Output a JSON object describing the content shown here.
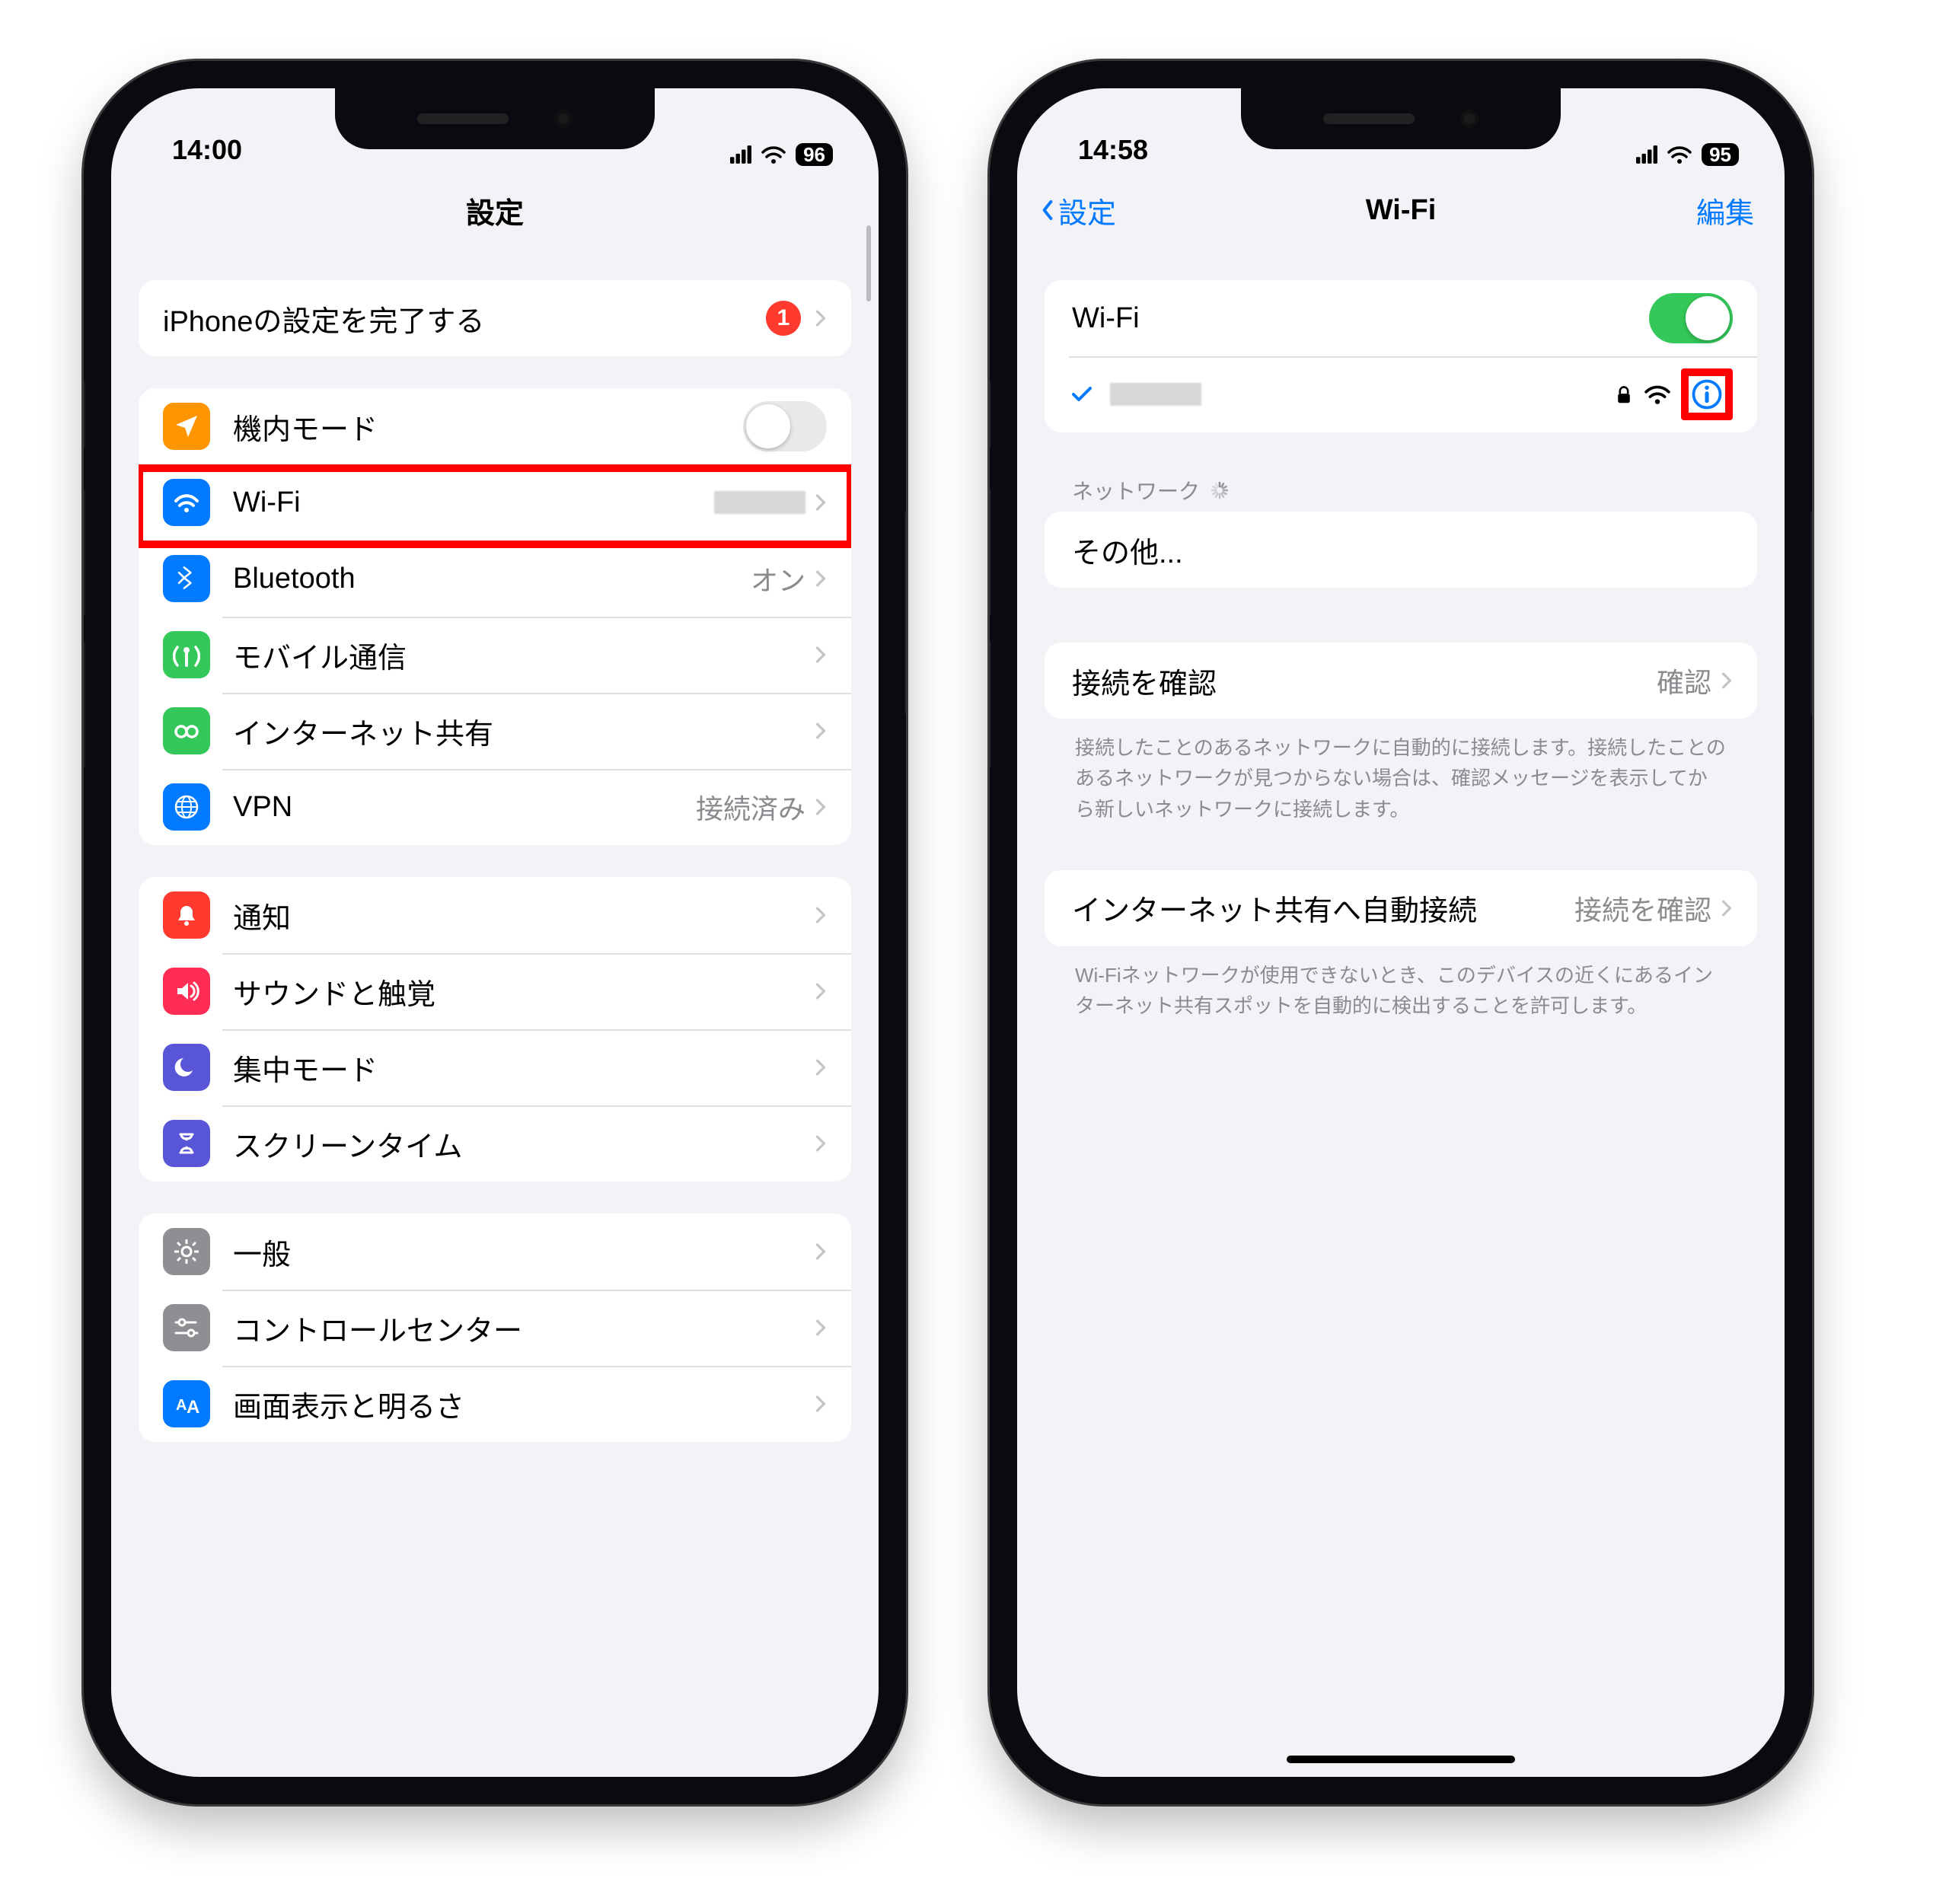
{
  "left": {
    "status": {
      "time": "14:00",
      "battery": "96"
    },
    "nav": {
      "title": "設定"
    },
    "setup": {
      "label": "iPhoneの設定を完了する",
      "badge": "1"
    },
    "group_net": {
      "airplane": {
        "label": "機内モード"
      },
      "wifi": {
        "label": "Wi-Fi"
      },
      "bluetooth": {
        "label": "Bluetooth",
        "detail": "オン"
      },
      "cellular": {
        "label": "モバイル通信"
      },
      "hotspot": {
        "label": "インターネット共有"
      },
      "vpn": {
        "label": "VPN",
        "detail": "接続済み"
      }
    },
    "group_notif": {
      "notifications": {
        "label": "通知"
      },
      "sounds": {
        "label": "サウンドと触覚"
      },
      "focus": {
        "label": "集中モード"
      },
      "screentime": {
        "label": "スクリーンタイム"
      }
    },
    "group_gen": {
      "general": {
        "label": "一般"
      },
      "control": {
        "label": "コントロールセンター"
      },
      "display": {
        "label": "画面表示と明るさ"
      }
    }
  },
  "right": {
    "status": {
      "time": "14:58",
      "battery": "95"
    },
    "nav": {
      "back": "設定",
      "title": "Wi-Fi",
      "action": "編集"
    },
    "wifi_toggle_label": "Wi-Fi",
    "networks_header": "ネットワーク",
    "other_label": "その他...",
    "ask_join": {
      "label": "接続を確認",
      "detail": "確認"
    },
    "ask_note": "接続したことのあるネットワークに自動的に接続します。接続したことのあるネットワークが見つからない場合は、確認メッセージを表示してから新しいネットワークに接続します。",
    "auto_hotspot": {
      "label": "インターネット共有へ自動接続",
      "detail": "接続を確認"
    },
    "auto_note": "Wi-Fiネットワークが使用できないとき、このデバイスの近くにあるインターネット共有スポットを自動的に検出することを許可します。"
  }
}
